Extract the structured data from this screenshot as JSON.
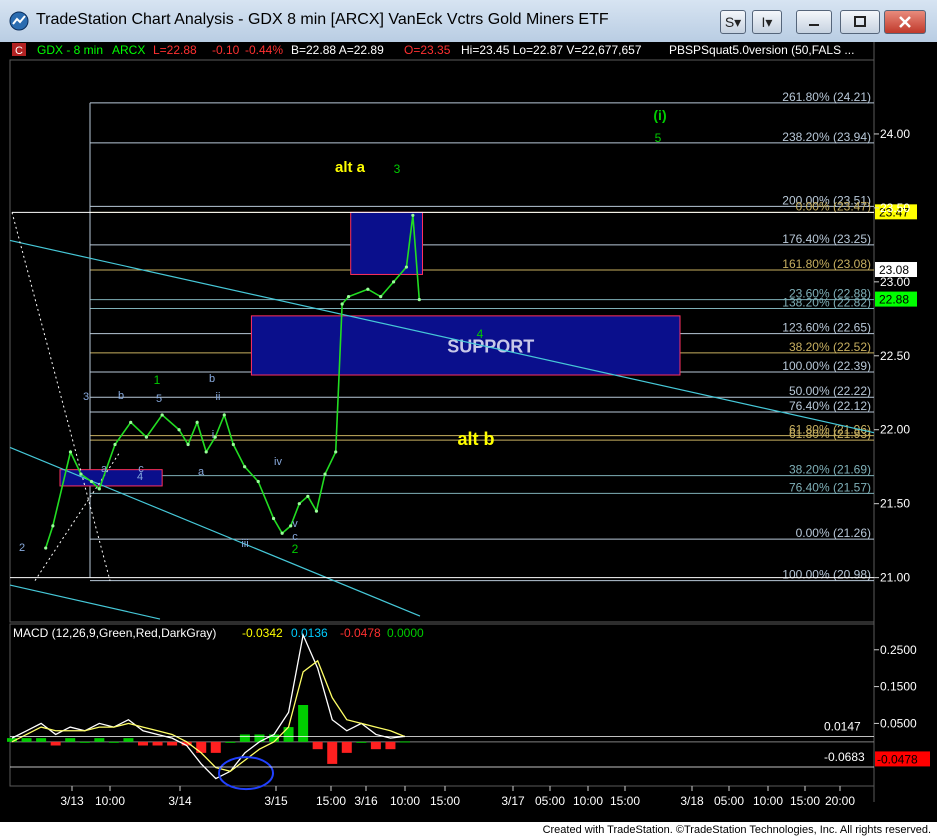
{
  "window": {
    "title": "TradeStation Chart Analysis - GDX 8 min [ARCX] VanEck Vctrs Gold Miners ETF",
    "btn_s": "S",
    "btn_i": "I"
  },
  "status_bar": {
    "badge": "C",
    "symbol": "GDX - 8 min",
    "exchange": "ARCX",
    "last": "L=22.88",
    "change": "-0.10",
    "pct": "-0.44%",
    "bidask": "B=22.88  A=22.89",
    "open": "O=23.35",
    "hilo": "Hi=23.45  Lo=22.87  V=22,677,657",
    "indicator": "PBSPSquat5.0version (50,FALS ..."
  },
  "macd_header": {
    "name": "MACD (12,26,9,Green,Red,DarkGray)",
    "v1": "-0.0342",
    "v2": "0.0136",
    "v3": "-0.0478",
    "v4": "0.0000"
  },
  "footer": {
    "credit": "Created with TradeStation. ©TradeStation Technologies, Inc. All rights reserved."
  },
  "chart_data": [
    {
      "type": "line",
      "y_axis_ticks": [
        "24.00",
        "23.50",
        "23.00",
        "22.50",
        "22.00",
        "21.50",
        "21.00"
      ],
      "ylim": [
        20.7,
        24.5
      ],
      "x_axis_labels": [
        "3/13",
        "10:00",
        "3/14",
        "3/15",
        "15:00",
        "3/16",
        "10:00",
        "15:00",
        "3/17",
        "05:00",
        "10:00",
        "15:00",
        "3/18",
        "05:00",
        "10:00",
        "15:00",
        "20:00"
      ],
      "price_tags": [
        {
          "label": "23.47",
          "value": 23.47,
          "bg": "#ffff00",
          "fg": "#000000"
        },
        {
          "label": "23.08",
          "value": 23.08,
          "bg": "#ffffff",
          "fg": "#000000"
        },
        {
          "label": "22.88",
          "value": 22.88,
          "bg": "#00ff00",
          "fg": "#000000"
        }
      ],
      "fib_levels": [
        {
          "label": "261.80% (24.21)",
          "value": 24.21,
          "color": "#b8c8d8"
        },
        {
          "label": "238.20% (23.94)",
          "value": 23.94,
          "color": "#b8c8d8"
        },
        {
          "label": "200.00% (23.51)",
          "value": 23.51,
          "color": "#b8c8d8"
        },
        {
          "label": "0.00% (23.47)",
          "value": 23.47,
          "color": "#c8b060"
        },
        {
          "label": "176.40% (23.25)",
          "value": 23.25,
          "color": "#b8c8d8"
        },
        {
          "label": "161.80% (23.08)",
          "value": 23.08,
          "color": "#c8b060"
        },
        {
          "label": "23.60% (22.88)",
          "value": 22.88,
          "color": "#7fb0b8"
        },
        {
          "label": "138.20% (22.82)",
          "value": 22.82,
          "color": "#7fb0b8"
        },
        {
          "label": "123.60% (22.65)",
          "value": 22.65,
          "color": "#b8c8d8"
        },
        {
          "label": "38.20% (22.52)",
          "value": 22.52,
          "color": "#c8b060"
        },
        {
          "label": "100.00% (22.39)",
          "value": 22.39,
          "color": "#b8c8d8"
        },
        {
          "label": "50.00% (22.22)",
          "value": 22.22,
          "color": "#b8c8d8"
        },
        {
          "label": "76.40% (22.12)",
          "value": 22.12,
          "color": "#b8c8d8"
        },
        {
          "label": "61.80% (21.96)",
          "value": 21.96,
          "color": "#c8b060"
        },
        {
          "label": "61.80% (21.93)",
          "value": 21.93,
          "color": "#c8b060"
        },
        {
          "label": "38.20% (21.69)",
          "value": 21.69,
          "color": "#7fb0b8"
        },
        {
          "label": "76.40% (21.57)",
          "value": 21.57,
          "color": "#7fb0b8"
        },
        {
          "label": "0.00% (21.26)",
          "value": 21.26,
          "color": "#b8c8d8"
        },
        {
          "label": "100.00% (20.98)",
          "value": 20.98,
          "color": "#b8c8d8"
        }
      ],
      "zones": [
        {
          "label": "",
          "y_top": 23.47,
          "y_bottom": 23.05,
          "x_start": "3/15 15:40",
          "x_end": "3/16 12:30"
        },
        {
          "label": "SUPPORT",
          "y_top": 22.77,
          "y_bottom": 22.37,
          "x_start": "3/14 15:00",
          "x_end": "3/17 16:00"
        },
        {
          "label": "",
          "y_top": 21.73,
          "y_bottom": 21.62,
          "x_start": "3/13 09:00",
          "x_end": "3/13 15:30"
        }
      ],
      "wave_labels": [
        "alt a",
        "3",
        "(i)",
        "5",
        "4",
        "alt b",
        "1",
        "3",
        "b",
        "5",
        "b",
        "ii",
        "i",
        "a",
        "4",
        "a",
        "c",
        "iii",
        "iv",
        "v",
        "c",
        "2",
        "2"
      ],
      "series": [
        {
          "name": "GDX",
          "x": [
            "3/12 14:00",
            "3/12 15:00",
            "3/13 09:40",
            "3/13 10:20",
            "3/13 11:00",
            "3/13 11:30",
            "3/13 12:30",
            "3/13 13:30",
            "3/13 14:30",
            "3/13 15:30",
            "3/14 09:40",
            "3/14 10:20",
            "3/14 11:00",
            "3/14 11:40",
            "3/14 12:20",
            "3/14 13:00",
            "3/14 13:40",
            "3/14 14:30",
            "3/14 15:30",
            "3/15 09:40",
            "3/15 10:20",
            "3/15 11:00",
            "3/15 11:40",
            "3/15 12:20",
            "3/15 13:00",
            "3/15 13:40",
            "3/15 14:30",
            "3/15 15:00",
            "3/15 15:30",
            "3/16 09:40",
            "3/16 10:20",
            "3/16 11:00",
            "3/16 11:40",
            "3/16 12:00",
            "3/16 12:20"
          ],
          "values": [
            21.2,
            21.35,
            21.85,
            21.7,
            21.65,
            21.6,
            21.9,
            22.05,
            21.95,
            22.1,
            22.0,
            21.9,
            22.05,
            21.85,
            21.95,
            22.1,
            21.9,
            21.75,
            21.65,
            21.4,
            21.3,
            21.35,
            21.5,
            21.55,
            21.45,
            21.7,
            21.85,
            22.85,
            22.9,
            22.95,
            22.9,
            23.0,
            23.1,
            23.45,
            22.88
          ]
        }
      ]
    },
    {
      "type": "line",
      "title": "MACD (12,26,9,Green,Red,DarkGray)",
      "y_axis_ticks": [
        "0.2500",
        "0.1500",
        "0.0500"
      ],
      "ylim": [
        -0.12,
        0.32
      ],
      "value_tags": [
        {
          "label": "0.0147",
          "value": 0.0147,
          "bg": "#000000",
          "fg": "#ffffff"
        },
        {
          "label": "-0.0683",
          "value": -0.0683,
          "bg": "#000000",
          "fg": "#ffffff"
        },
        {
          "label": "-0.0478",
          "value": -0.0478,
          "bg": "#ff0000",
          "fg": "#000000"
        }
      ],
      "series": [
        {
          "name": "MACD",
          "values": [
            0.01,
            0.03,
            0.05,
            0.02,
            0.04,
            0.03,
            0.05,
            0.04,
            0.06,
            0.03,
            0.02,
            0.01,
            -0.01,
            -0.06,
            -0.1,
            -0.08,
            -0.03,
            0.0,
            0.02,
            0.08,
            0.29,
            0.2,
            0.06,
            0.03,
            0.05,
            0.02,
            0.01,
            0.015
          ]
        },
        {
          "name": "Signal",
          "values": [
            0.0,
            0.02,
            0.04,
            0.03,
            0.03,
            0.03,
            0.04,
            0.04,
            0.05,
            0.04,
            0.03,
            0.02,
            0.0,
            -0.03,
            -0.07,
            -0.08,
            -0.05,
            -0.02,
            0.0,
            0.04,
            0.19,
            0.22,
            0.12,
            0.06,
            0.05,
            0.04,
            0.03,
            0.014
          ]
        }
      ]
    }
  ]
}
